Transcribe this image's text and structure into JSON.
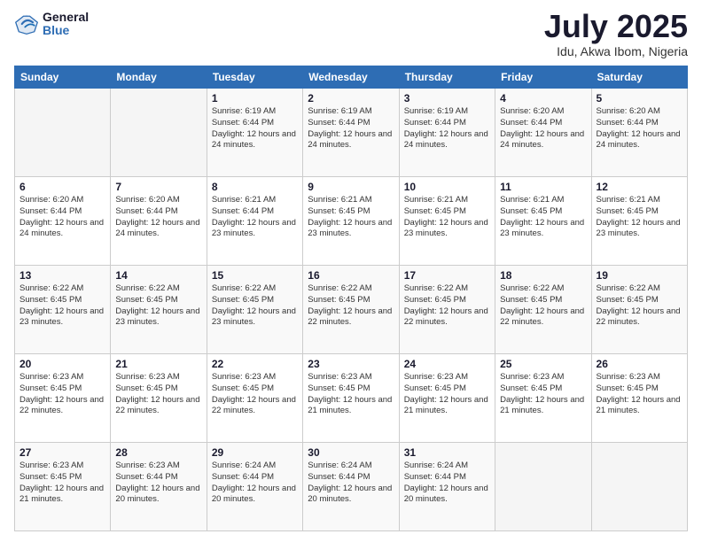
{
  "header": {
    "logo_general": "General",
    "logo_blue": "Blue",
    "month_title": "July 2025",
    "location": "Idu, Akwa Ibom, Nigeria"
  },
  "days_of_week": [
    "Sunday",
    "Monday",
    "Tuesday",
    "Wednesday",
    "Thursday",
    "Friday",
    "Saturday"
  ],
  "weeks": [
    [
      {
        "day": "",
        "info": ""
      },
      {
        "day": "",
        "info": ""
      },
      {
        "day": "1",
        "info": "Sunrise: 6:19 AM\nSunset: 6:44 PM\nDaylight: 12 hours and 24 minutes."
      },
      {
        "day": "2",
        "info": "Sunrise: 6:19 AM\nSunset: 6:44 PM\nDaylight: 12 hours and 24 minutes."
      },
      {
        "day": "3",
        "info": "Sunrise: 6:19 AM\nSunset: 6:44 PM\nDaylight: 12 hours and 24 minutes."
      },
      {
        "day": "4",
        "info": "Sunrise: 6:20 AM\nSunset: 6:44 PM\nDaylight: 12 hours and 24 minutes."
      },
      {
        "day": "5",
        "info": "Sunrise: 6:20 AM\nSunset: 6:44 PM\nDaylight: 12 hours and 24 minutes."
      }
    ],
    [
      {
        "day": "6",
        "info": "Sunrise: 6:20 AM\nSunset: 6:44 PM\nDaylight: 12 hours and 24 minutes."
      },
      {
        "day": "7",
        "info": "Sunrise: 6:20 AM\nSunset: 6:44 PM\nDaylight: 12 hours and 24 minutes."
      },
      {
        "day": "8",
        "info": "Sunrise: 6:21 AM\nSunset: 6:44 PM\nDaylight: 12 hours and 23 minutes."
      },
      {
        "day": "9",
        "info": "Sunrise: 6:21 AM\nSunset: 6:45 PM\nDaylight: 12 hours and 23 minutes."
      },
      {
        "day": "10",
        "info": "Sunrise: 6:21 AM\nSunset: 6:45 PM\nDaylight: 12 hours and 23 minutes."
      },
      {
        "day": "11",
        "info": "Sunrise: 6:21 AM\nSunset: 6:45 PM\nDaylight: 12 hours and 23 minutes."
      },
      {
        "day": "12",
        "info": "Sunrise: 6:21 AM\nSunset: 6:45 PM\nDaylight: 12 hours and 23 minutes."
      }
    ],
    [
      {
        "day": "13",
        "info": "Sunrise: 6:22 AM\nSunset: 6:45 PM\nDaylight: 12 hours and 23 minutes."
      },
      {
        "day": "14",
        "info": "Sunrise: 6:22 AM\nSunset: 6:45 PM\nDaylight: 12 hours and 23 minutes."
      },
      {
        "day": "15",
        "info": "Sunrise: 6:22 AM\nSunset: 6:45 PM\nDaylight: 12 hours and 23 minutes."
      },
      {
        "day": "16",
        "info": "Sunrise: 6:22 AM\nSunset: 6:45 PM\nDaylight: 12 hours and 22 minutes."
      },
      {
        "day": "17",
        "info": "Sunrise: 6:22 AM\nSunset: 6:45 PM\nDaylight: 12 hours and 22 minutes."
      },
      {
        "day": "18",
        "info": "Sunrise: 6:22 AM\nSunset: 6:45 PM\nDaylight: 12 hours and 22 minutes."
      },
      {
        "day": "19",
        "info": "Sunrise: 6:22 AM\nSunset: 6:45 PM\nDaylight: 12 hours and 22 minutes."
      }
    ],
    [
      {
        "day": "20",
        "info": "Sunrise: 6:23 AM\nSunset: 6:45 PM\nDaylight: 12 hours and 22 minutes."
      },
      {
        "day": "21",
        "info": "Sunrise: 6:23 AM\nSunset: 6:45 PM\nDaylight: 12 hours and 22 minutes."
      },
      {
        "day": "22",
        "info": "Sunrise: 6:23 AM\nSunset: 6:45 PM\nDaylight: 12 hours and 22 minutes."
      },
      {
        "day": "23",
        "info": "Sunrise: 6:23 AM\nSunset: 6:45 PM\nDaylight: 12 hours and 21 minutes."
      },
      {
        "day": "24",
        "info": "Sunrise: 6:23 AM\nSunset: 6:45 PM\nDaylight: 12 hours and 21 minutes."
      },
      {
        "day": "25",
        "info": "Sunrise: 6:23 AM\nSunset: 6:45 PM\nDaylight: 12 hours and 21 minutes."
      },
      {
        "day": "26",
        "info": "Sunrise: 6:23 AM\nSunset: 6:45 PM\nDaylight: 12 hours and 21 minutes."
      }
    ],
    [
      {
        "day": "27",
        "info": "Sunrise: 6:23 AM\nSunset: 6:45 PM\nDaylight: 12 hours and 21 minutes."
      },
      {
        "day": "28",
        "info": "Sunrise: 6:23 AM\nSunset: 6:44 PM\nDaylight: 12 hours and 20 minutes."
      },
      {
        "day": "29",
        "info": "Sunrise: 6:24 AM\nSunset: 6:44 PM\nDaylight: 12 hours and 20 minutes."
      },
      {
        "day": "30",
        "info": "Sunrise: 6:24 AM\nSunset: 6:44 PM\nDaylight: 12 hours and 20 minutes."
      },
      {
        "day": "31",
        "info": "Sunrise: 6:24 AM\nSunset: 6:44 PM\nDaylight: 12 hours and 20 minutes."
      },
      {
        "day": "",
        "info": ""
      },
      {
        "day": "",
        "info": ""
      }
    ]
  ]
}
